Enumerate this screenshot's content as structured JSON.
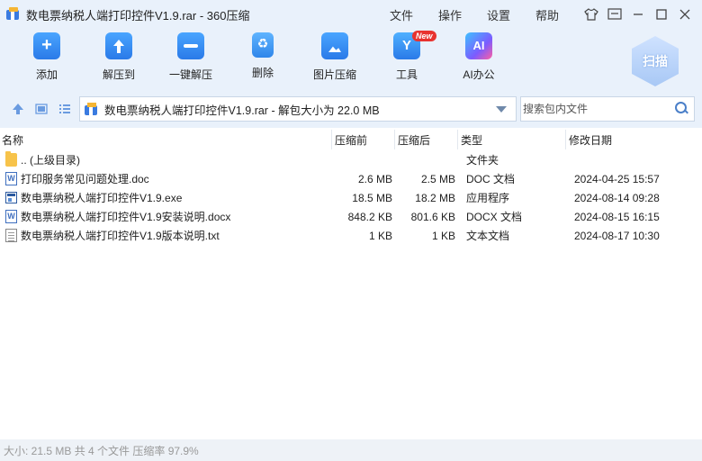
{
  "window": {
    "title": "数电票纳税人端打印控件V1.9.rar - 360压缩",
    "menu": [
      "文件",
      "操作",
      "设置",
      "帮助"
    ]
  },
  "toolbar": {
    "buttons": [
      {
        "label": "添加",
        "icon": "add-icon"
      },
      {
        "label": "解压到",
        "icon": "extract-icon"
      },
      {
        "label": "一键解压",
        "icon": "one-key-extract-icon"
      },
      {
        "label": "删除",
        "icon": "delete-icon"
      },
      {
        "label": "图片压缩",
        "icon": "image-compress-icon"
      },
      {
        "label": "工具",
        "icon": "tools-icon",
        "badge": "New"
      },
      {
        "label": "AI办公",
        "icon": "ai-office-icon"
      }
    ],
    "scan_label": "扫描"
  },
  "address": {
    "path": "数电票纳税人端打印控件V1.9.rar - 解包大小为 22.0 MB",
    "search_placeholder": "搜索包内文件"
  },
  "columns": {
    "name": "名称",
    "compressed": "压缩前",
    "original": "压缩后",
    "type": "类型",
    "modified": "修改日期"
  },
  "files": [
    {
      "icon": "folder",
      "name": ".. (上级目录)",
      "csize": "",
      "osize": "",
      "type": "文件夹",
      "date": ""
    },
    {
      "icon": "doc",
      "name": "打印服务常见问题处理.doc",
      "csize": "2.6 MB",
      "osize": "2.5 MB",
      "type": "DOC 文档",
      "date": "2024-04-25 15:57"
    },
    {
      "icon": "exe",
      "name": "数电票纳税人端打印控件V1.9.exe",
      "csize": "18.5 MB",
      "osize": "18.2 MB",
      "type": "应用程序",
      "date": "2024-08-14 09:28"
    },
    {
      "icon": "doc",
      "name": "数电票纳税人端打印控件V1.9安装说明.docx",
      "csize": "848.2 KB",
      "osize": "801.6 KB",
      "type": "DOCX 文档",
      "date": "2024-08-15 16:15"
    },
    {
      "icon": "txt",
      "name": "数电票纳税人端打印控件V1.9版本说明.txt",
      "csize": "1 KB",
      "osize": "1 KB",
      "type": "文本文档",
      "date": "2024-08-17 10:30"
    }
  ],
  "status": "大小: 21.5 MB 共 4 个文件 压缩率 97.9%"
}
